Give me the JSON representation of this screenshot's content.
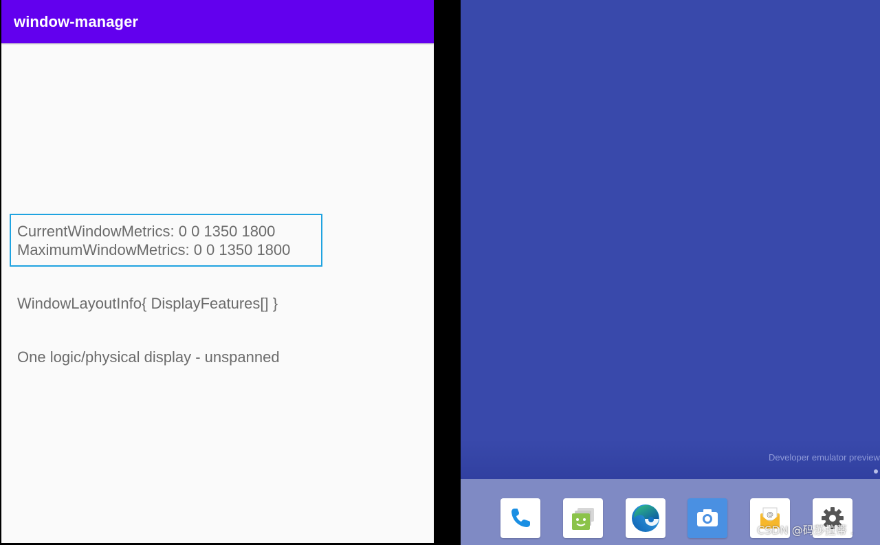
{
  "app": {
    "title": "window-manager",
    "accent_color": "#6200ee",
    "highlight_color": "#1fa3e0"
  },
  "content": {
    "current_window_metrics": "CurrentWindowMetrics: 0 0 1350 1800",
    "maximum_window_metrics": "MaximumWindowMetrics: 0 0 1350 1800",
    "window_layout_info": "WindowLayoutInfo{ DisplayFeatures[] }",
    "display_state": "One logic/physical display - unspanned"
  },
  "launcher": {
    "background_color": "#3949ab",
    "watermark": "Developer emulator preview",
    "dock": {
      "apps": [
        {
          "name": "phone",
          "icon": "phone-icon"
        },
        {
          "name": "messages",
          "icon": "messages-icon"
        },
        {
          "name": "browser",
          "icon": "edge-browser-icon"
        },
        {
          "name": "camera",
          "icon": "camera-icon"
        },
        {
          "name": "email",
          "icon": "email-icon"
        },
        {
          "name": "settings",
          "icon": "gear-icon"
        }
      ]
    }
  },
  "overlay": {
    "csdn_watermark": "CSDN @码莎拉蒂 ."
  }
}
